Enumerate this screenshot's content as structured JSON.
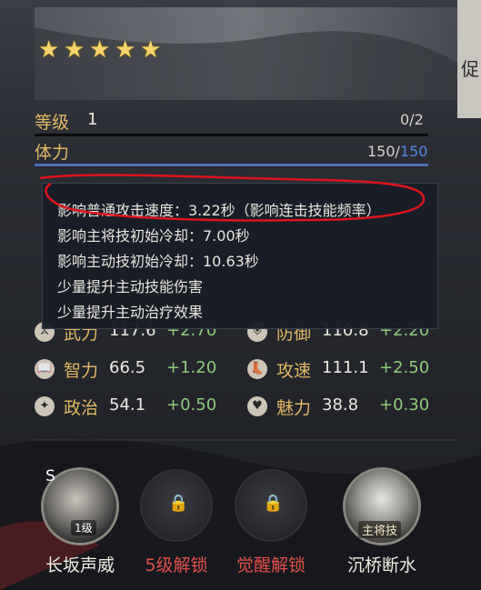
{
  "stars": 5,
  "level": {
    "label": "等级",
    "value": "1",
    "exp": "0/2"
  },
  "stamina": {
    "label": "体力",
    "current": "150",
    "max": "150",
    "fill": 1.0
  },
  "tooltip": {
    "lines": [
      "影响普通攻击速度：3.22秒（影响连击技能频率）",
      "影响主将技初始冷却：7.00秒",
      "影响主动技初始冷却：10.63秒",
      "少量提升主动技能伤害",
      "少量提升主动治疗效果"
    ]
  },
  "stats": [
    {
      "name": "武力",
      "value": "117.6",
      "bonus": "+2.70",
      "icon": "sword-icon"
    },
    {
      "name": "防御",
      "value": "110.8",
      "bonus": "+2.20",
      "icon": "shield-icon"
    },
    {
      "name": "智力",
      "value": "66.5",
      "bonus": "+1.20",
      "icon": "book-icon"
    },
    {
      "name": "攻速",
      "value": "111.1",
      "bonus": "+2.50",
      "icon": "boot-icon"
    },
    {
      "name": "政治",
      "value": "54.1",
      "bonus": "+0.50",
      "icon": "emblem-icon"
    },
    {
      "name": "魅力",
      "value": "38.8",
      "bonus": "+0.30",
      "icon": "heart-icon"
    }
  ],
  "skills": [
    {
      "name": "长坂声威",
      "badge": "1级",
      "corner": "S",
      "color": "#f1ece2"
    },
    {
      "name": "5级解锁",
      "color": "#e2504a"
    },
    {
      "name": "觉醒解锁",
      "color": "#e2504a"
    },
    {
      "name": "沉桥断水",
      "badge": "主将技",
      "color": "#f1ece2"
    }
  ],
  "side_tab": {
    "text": "促"
  }
}
